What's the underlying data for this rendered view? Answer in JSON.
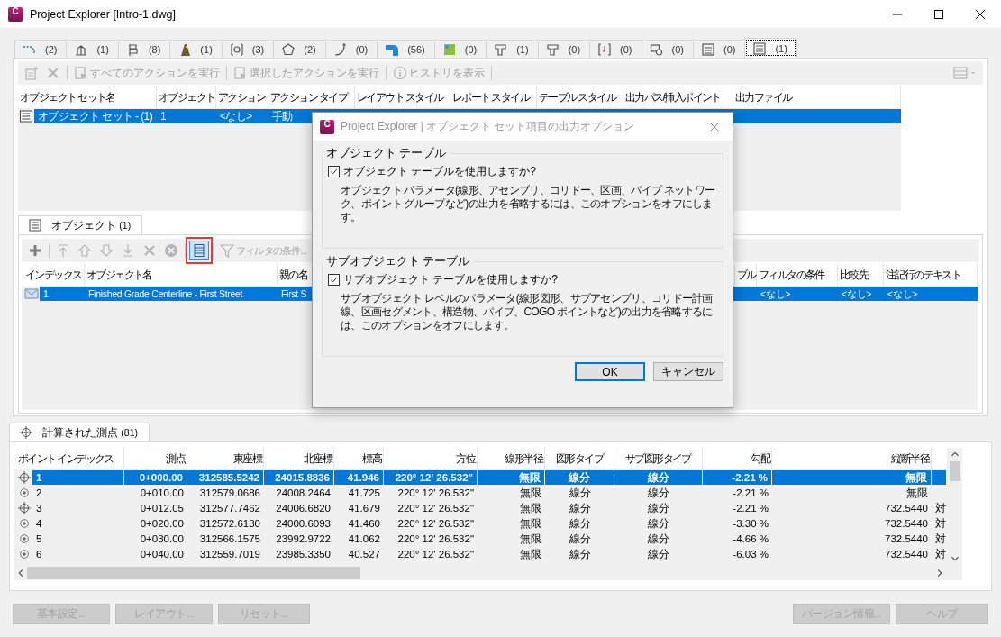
{
  "window": {
    "title": "Project Explorer [Intro-1.dwg]",
    "icon_letter": "C"
  },
  "object_type_tabs": [
    {
      "count": "(2)",
      "selected": false
    },
    {
      "count": "(1)",
      "selected": false
    },
    {
      "count": "(8)",
      "selected": false
    },
    {
      "count": "(1)",
      "selected": false
    },
    {
      "count": "(3)",
      "selected": false
    },
    {
      "count": "(2)",
      "selected": false
    },
    {
      "count": "(0)",
      "selected": false
    },
    {
      "count": "(56)",
      "selected": false
    },
    {
      "count": "(0)",
      "selected": false
    },
    {
      "count": "(1)",
      "selected": false
    },
    {
      "count": "(0)",
      "selected": false
    },
    {
      "count": "(0)",
      "selected": false
    },
    {
      "count": "(0)",
      "selected": false
    },
    {
      "count": "(0)",
      "selected": false
    },
    {
      "count": "(1)",
      "selected": true
    }
  ],
  "action_toolbar": [
    {
      "kind": "icon",
      "disabled": true
    },
    {
      "kind": "icon",
      "disabled": true
    },
    {
      "kind": "labeled",
      "label": "すべてのアクションを実行",
      "disabled": true
    },
    {
      "kind": "labeled",
      "label": "選択したアクションを実行",
      "disabled": true
    },
    {
      "kind": "labeled",
      "label": "ヒストリを表示",
      "disabled": true
    },
    {
      "kind": "menu",
      "disabled": true
    }
  ],
  "object_sets_table": {
    "columns": [
      "オブジェクト セット名",
      "オブジェクト",
      "アクション",
      "アクション タイプ",
      "レイアウト スタイル",
      "レポート スタイル",
      "テーブル スタイル",
      "出力パス/挿入ポイント",
      "出力ファイル"
    ],
    "rows": [
      {
        "selected": true,
        "cells": [
          "オブジェクト セット - (1)",
          "1",
          "<なし>",
          "手動"
        ]
      }
    ]
  },
  "objects_tab": {
    "label": "オブジェクト",
    "count": "(1)"
  },
  "objects_toolbar": [
    {
      "kind": "icon",
      "disabled": false,
      "highlighted": false
    },
    {
      "kind": "icon",
      "disabled": true,
      "highlighted": false
    },
    {
      "kind": "icon",
      "disabled": true,
      "highlighted": false
    },
    {
      "kind": "icon",
      "disabled": true,
      "highlighted": false
    },
    {
      "kind": "icon",
      "disabled": true,
      "highlighted": false
    },
    {
      "kind": "icon",
      "disabled": true,
      "highlighted": false
    },
    {
      "kind": "icon",
      "disabled": true,
      "highlighted": false
    },
    {
      "kind": "icon",
      "disabled": false,
      "highlighted": true
    },
    {
      "kind": "labeled",
      "label": "フィルタの条件...",
      "disabled": true,
      "highlighted": false
    }
  ],
  "objects_table": {
    "columns": [
      "インデックス",
      "オブジェクト名",
      "親の名",
      "ブル",
      "フィルタの条件",
      "比較先",
      "注記行のテキスト"
    ],
    "rows": [
      {
        "selected": true,
        "cells": [
          "1",
          "Finished Grade Centerline - First Street",
          "First S",
          "",
          "<なし>",
          "<なし>",
          "<なし>"
        ]
      }
    ]
  },
  "points_tab": {
    "label": "計算された測点",
    "count": "(81)"
  },
  "points_table": {
    "columns": [
      "ポイント インデックス",
      "測点",
      "東座標",
      "北座標",
      "標高",
      "方位",
      "線形半径",
      "図形タイプ",
      "サブ図形タイプ",
      "勾配",
      "縦断半径"
    ],
    "rows": [
      {
        "kind": "crosshair",
        "selected": true,
        "cells": [
          "1",
          "0+000.00",
          "312585.5242",
          "24015.8836",
          "41.946",
          "220° 12' 26.532\"",
          "無限",
          "線分",
          "線分",
          "-2.21 %",
          "無限"
        ]
      },
      {
        "kind": "target",
        "selected": false,
        "cells": [
          "2",
          "0+010.00",
          "312579.0686",
          "24008.2464",
          "41.725",
          "220° 12' 26.532\"",
          "無限",
          "線分",
          "線分",
          "-2.21 %",
          "無限"
        ]
      },
      {
        "kind": "crosshair",
        "selected": false,
        "cells": [
          "3",
          "0+012.05",
          "312577.7462",
          "24006.6820",
          "41.679",
          "220° 12' 26.532\"",
          "無限",
          "線分",
          "線分",
          "-2.21 %",
          "732.5440",
          "対"
        ]
      },
      {
        "kind": "target",
        "selected": false,
        "cells": [
          "4",
          "0+020.00",
          "312572.6130",
          "24000.6093",
          "41.460",
          "220° 12' 26.532\"",
          "無限",
          "線分",
          "線分",
          "-3.30 %",
          "732.5440",
          "対"
        ]
      },
      {
        "kind": "target",
        "selected": false,
        "cells": [
          "5",
          "0+030.00",
          "312566.1575",
          "23992.9722",
          "41.062",
          "220° 12' 26.532\"",
          "無限",
          "線分",
          "線分",
          "-4.66 %",
          "732.5440",
          "対"
        ]
      },
      {
        "kind": "target",
        "selected": false,
        "cells": [
          "6",
          "0+040.00",
          "312559.7019",
          "23985.3350",
          "40.527",
          "220° 12' 26.532\"",
          "無限",
          "線分",
          "線分",
          "-6.03 %",
          "732.5440",
          "対"
        ]
      }
    ]
  },
  "footer_buttons": {
    "left": [
      {
        "label": "基本設定...",
        "disabled": true
      },
      {
        "label": "レイアウト...",
        "disabled": true
      },
      {
        "label": "リセット...",
        "disabled": true
      }
    ],
    "right": [
      {
        "label": "バージョン情報...",
        "disabled": true
      },
      {
        "label": "ヘルプ",
        "disabled": true
      }
    ]
  },
  "dialog": {
    "title": "Project Explorer | オブジェクト セット項目の出力オプション",
    "icon_letter": "C",
    "groups": [
      {
        "title": "オブジェクト テーブル",
        "checkbox": {
          "label": "オブジェクト テーブルを使用しますか?",
          "checked": true
        },
        "description": "オブジェクト パラメータ(線形、アセンブリ、コリドー、区画、パイプ ネットワーク、ポイント グループなど)の出力を省略するには、このオプションをオフにします。"
      },
      {
        "title": "サブオブジェクト テーブル",
        "checkbox": {
          "label": "サブオブジェクト テーブルを使用しますか?",
          "checked": true
        },
        "description": "サブオブジェクト レベルのパラメータ(線形図形、サブアセンブリ、コリドー計画線、区画セグメント、構造物、パイプ、COGO ポイントなど)の出力を省略するには、このオプションをオフにします。"
      }
    ],
    "buttons": [
      {
        "label": "OK",
        "default": true
      },
      {
        "label": "キャンセル",
        "default": false
      }
    ]
  }
}
